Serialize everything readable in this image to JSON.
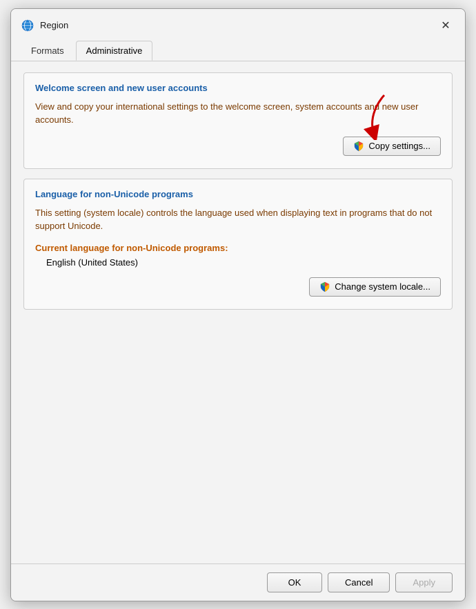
{
  "window": {
    "title": "Region",
    "icon": "globe-icon"
  },
  "tabs": [
    {
      "id": "formats",
      "label": "Formats",
      "active": false
    },
    {
      "id": "administrative",
      "label": "Administrative",
      "active": true
    }
  ],
  "sections": {
    "welcome_screen": {
      "title": "Welcome screen and new user accounts",
      "description": "View and copy your international settings to the welcome screen, system accounts and new user accounts.",
      "button_label": "Copy settings..."
    },
    "non_unicode": {
      "title": "Language for non-Unicode programs",
      "description": "This setting (system locale) controls the language used when displaying text in programs that do not support Unicode.",
      "current_lang_label": "Current language for ",
      "current_lang_highlight": "non-Unicode programs",
      "current_lang_suffix": ":",
      "current_lang_value": "English (United States)",
      "button_label": "Change system locale..."
    }
  },
  "bottom_bar": {
    "ok_label": "OK",
    "cancel_label": "Cancel",
    "apply_label": "Apply"
  }
}
